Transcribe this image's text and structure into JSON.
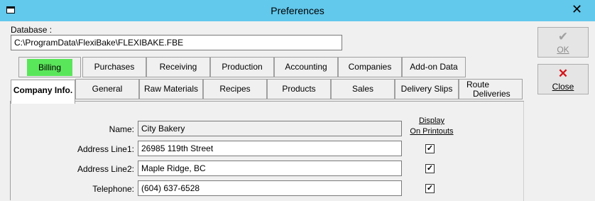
{
  "window": {
    "title": "Preferences"
  },
  "database": {
    "label": "Database :",
    "value": "C:\\ProgramData\\FlexiBake\\FLEXIBAKE.FBE"
  },
  "buttons": {
    "ok": {
      "label": "OK",
      "icon": "checkmark-icon",
      "enabled": false
    },
    "close": {
      "label": "Close",
      "icon": "red-x-icon",
      "enabled": true
    }
  },
  "tabs_row1": [
    {
      "label": "Billing",
      "highlight": "#5ae65a"
    },
    {
      "label": "Purchases"
    },
    {
      "label": "Receiving"
    },
    {
      "label": "Production"
    },
    {
      "label": "Accounting"
    },
    {
      "label": "Companies"
    },
    {
      "label": "Add-on Data"
    }
  ],
  "tabs_row2": [
    {
      "label": "Company Info.",
      "active": true
    },
    {
      "label": "General"
    },
    {
      "label": "Raw Materials"
    },
    {
      "label": "Recipes"
    },
    {
      "label": "Products"
    },
    {
      "label": "Sales"
    },
    {
      "label": "Delivery Slips"
    },
    {
      "label_line1": "Route",
      "label_line2": "Deliveries"
    }
  ],
  "company_info": {
    "display_header_line1": "Display",
    "display_header_line2": "On Printouts",
    "fields": [
      {
        "label": "Name:",
        "value": "City Bakery",
        "readonly": true,
        "display": null
      },
      {
        "label": "Address Line1:",
        "value": "26985 119th Street",
        "readonly": false,
        "display": true
      },
      {
        "label": "Address Line2:",
        "value": "Maple Ridge, BC",
        "readonly": false,
        "display": true
      },
      {
        "label": "Telephone:",
        "value": "(604) 637-6528",
        "readonly": false,
        "display": true
      }
    ]
  }
}
